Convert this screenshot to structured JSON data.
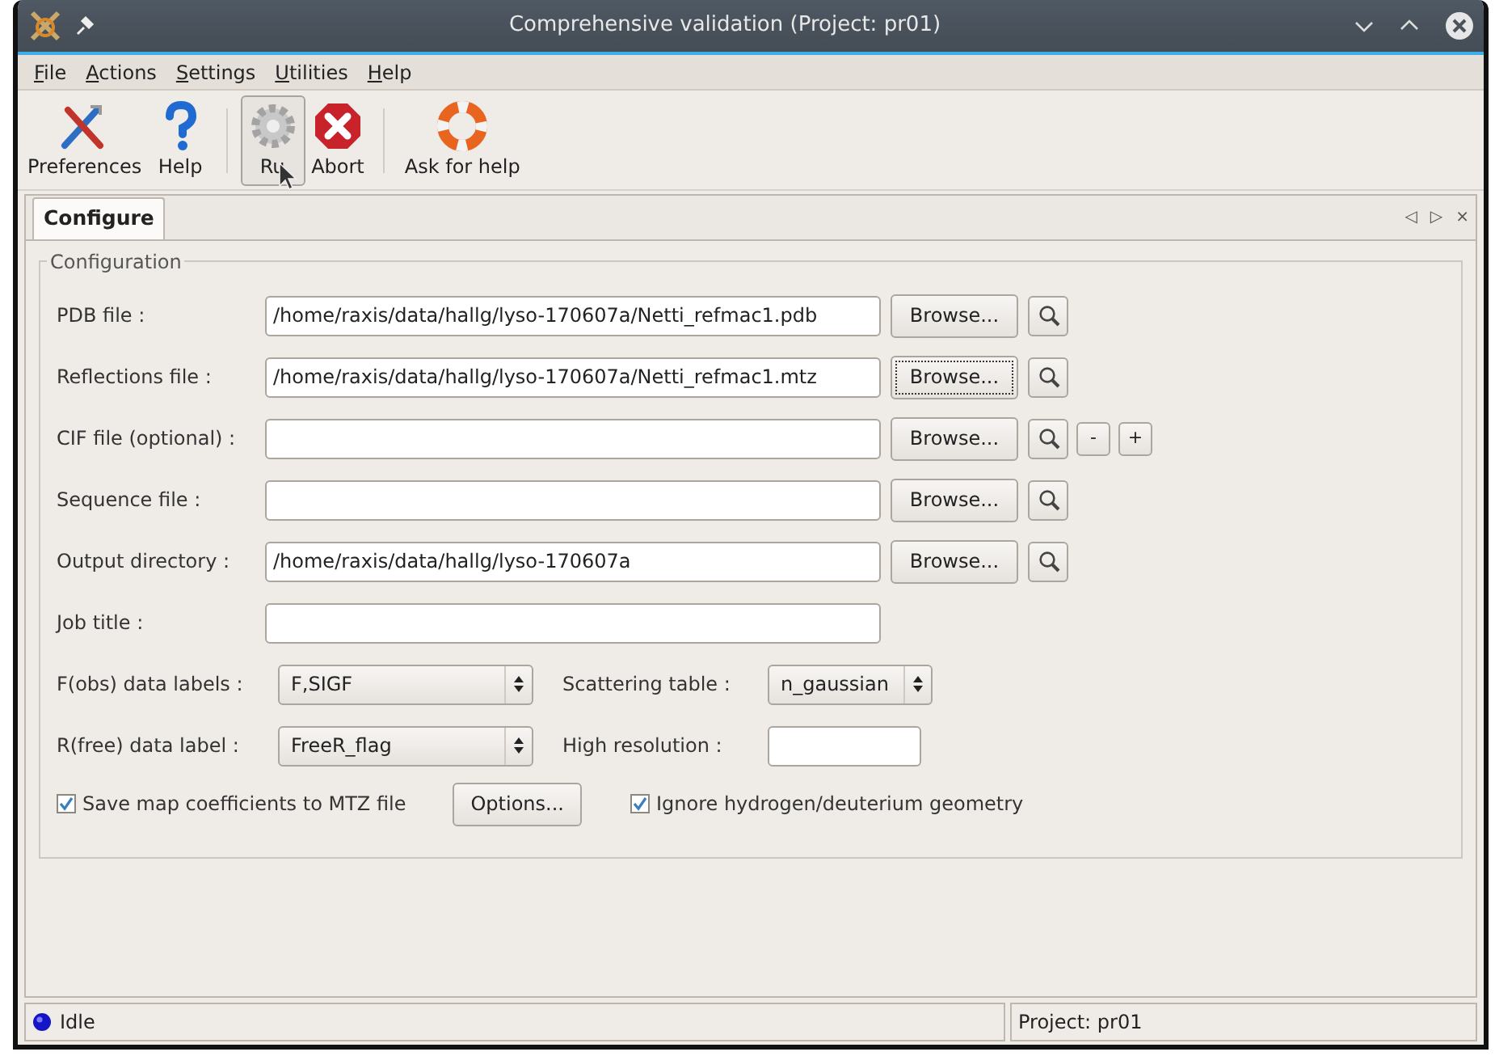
{
  "window": {
    "title": "Comprehensive validation (Project: pr01)"
  },
  "menu": [
    {
      "label": "File"
    },
    {
      "label": "Actions"
    },
    {
      "label": "Settings"
    },
    {
      "label": "Utilities"
    },
    {
      "label": "Help"
    }
  ],
  "toolbar": [
    [
      {
        "kind": "preferences",
        "label": "Preferences",
        "hovered": false
      },
      {
        "kind": "help",
        "label": "Help",
        "hovered": false
      }
    ],
    [
      {
        "kind": "run",
        "label": "Ru",
        "hovered": true
      },
      {
        "kind": "abort",
        "label": "Abort",
        "hovered": false
      }
    ],
    [
      {
        "kind": "lifebuoy",
        "label": "Ask for help",
        "hovered": false
      }
    ]
  ],
  "tabs": [
    {
      "label": "Configure",
      "selected": true
    }
  ],
  "tab_controls": [
    "◁",
    "▷",
    "×"
  ],
  "group": {
    "title": "Configuration",
    "rows": [
      {
        "kind": "file",
        "label": "PDB file :",
        "value": "/home/raxis/data/hallg/lyso-170607a/Netti_refmac1.pdb",
        "button": "Browse...",
        "focused": false
      },
      {
        "kind": "file",
        "label": "Reflections file :",
        "value": "/home/raxis/data/hallg/lyso-170607a/Netti_refmac1.mtz",
        "button": "Browse...",
        "focused": true
      },
      {
        "kind": "file",
        "label": "CIF file (optional) :",
        "button": "Browse...",
        "focused": false,
        "extra": [
          "-",
          "+"
        ]
      },
      {
        "kind": "file",
        "label": "Sequence file :",
        "button": "Browse...",
        "focused": false
      },
      {
        "kind": "file",
        "label": "Output directory :",
        "value": "/home/raxis/data/hallg/lyso-170607a",
        "button": "Browse...",
        "focused": false
      },
      {
        "kind": "text",
        "label": "Job title :"
      },
      {
        "kind": "pair",
        "label": "F(obs) data labels :",
        "select": "F,SIGF",
        "label2": "Scattering table :",
        "select2": "n_gaussian"
      },
      {
        "kind": "pair",
        "label": "R(free) data label :",
        "select": "FreeR_flag",
        "label2": "High resolution :"
      },
      {
        "kind": "checks",
        "check": {
          "label": "Save map coefficients to MTZ file",
          "checked": true
        },
        "button": "Options...",
        "check2": {
          "label": "Ignore hydrogen/deuterium geometry",
          "checked": true
        }
      }
    ]
  },
  "status_bar": {
    "state": "Idle",
    "project": "Project: pr01"
  }
}
